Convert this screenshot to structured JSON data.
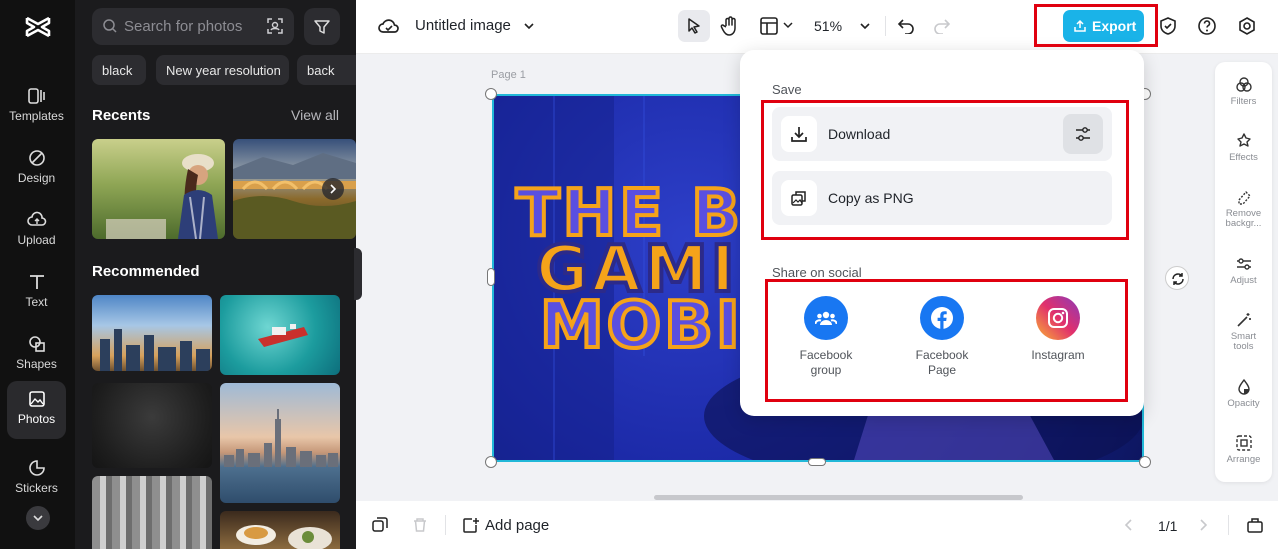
{
  "rail": {
    "items": [
      {
        "label": "Templates",
        "icon": "templates-icon"
      },
      {
        "label": "Design",
        "icon": "design-icon"
      },
      {
        "label": "Upload",
        "icon": "upload-icon"
      },
      {
        "label": "Text",
        "icon": "text-icon"
      },
      {
        "label": "Shapes",
        "icon": "shapes-icon"
      },
      {
        "label": "Photos",
        "icon": "photos-icon",
        "active": true
      },
      {
        "label": "Stickers",
        "icon": "stickers-icon"
      }
    ]
  },
  "panel": {
    "search_placeholder": "Search for photos",
    "chips": [
      "black",
      "New year resolution",
      "back"
    ],
    "recents_title": "Recents",
    "view_all": "View all",
    "recommended_title": "Recommended"
  },
  "topbar": {
    "doc_title": "Untitled image",
    "zoom": "51%",
    "export_label": "Export"
  },
  "canvas": {
    "page_label": "Page 1",
    "headline_lines": [
      "THE BE",
      "GAMIN",
      "MOBIL"
    ]
  },
  "export_menu": {
    "save_heading": "Save",
    "download_label": "Download",
    "copy_png_label": "Copy as PNG",
    "social_heading": "Share on social",
    "social": [
      {
        "label_line1": "Facebook",
        "label_line2": "group",
        "color": "#1877f2"
      },
      {
        "label_line1": "Facebook",
        "label_line2": "Page",
        "color": "#1877f2"
      },
      {
        "label_line1": "Instagram",
        "label_line2": "",
        "color": "#e1306c"
      }
    ]
  },
  "tools": {
    "items": [
      {
        "l1": "Filters",
        "l2": ""
      },
      {
        "l1": "Effects",
        "l2": ""
      },
      {
        "l1": "Remove",
        "l2": "backgr..."
      },
      {
        "l1": "Adjust",
        "l2": ""
      },
      {
        "l1": "Smart",
        "l2": "tools"
      },
      {
        "l1": "Opacity",
        "l2": ""
      },
      {
        "l1": "Arrange",
        "l2": ""
      }
    ]
  },
  "bottombar": {
    "add_page": "Add page",
    "pager": "1/1"
  },
  "colors": {
    "accent": "#1ab3e8",
    "highlight": "#e0000f",
    "canvas_bg": "#1c2aa8"
  }
}
